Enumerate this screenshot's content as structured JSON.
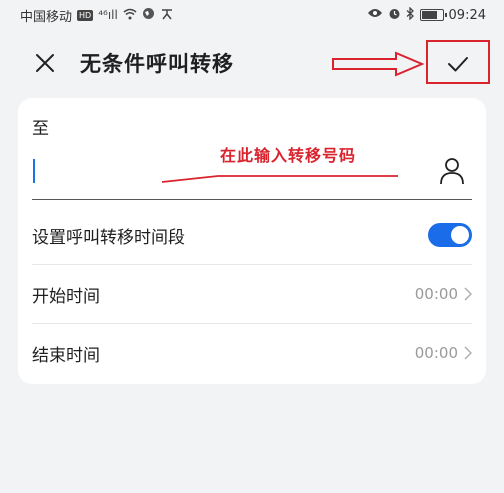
{
  "status_bar": {
    "carrier": "中国移动",
    "hd_badge": "HD",
    "signal_label": "⁴⁶ıll",
    "time": "09:24"
  },
  "header": {
    "title": "无条件呼叫转移"
  },
  "form": {
    "to_label": "至",
    "number_value": "",
    "number_placeholder": ""
  },
  "annotation": {
    "text": "在此输入转移号码"
  },
  "settings": {
    "time_period_label": "设置呼叫转移时间段",
    "time_period_enabled": true,
    "start_time_label": "开始时间",
    "start_time_value": "00:00",
    "end_time_label": "结束时间",
    "end_time_value": "00:00"
  },
  "colors": {
    "accent": "#1a6ce8",
    "annotation_red": "#d9232d",
    "background": "#f1f3f5"
  }
}
